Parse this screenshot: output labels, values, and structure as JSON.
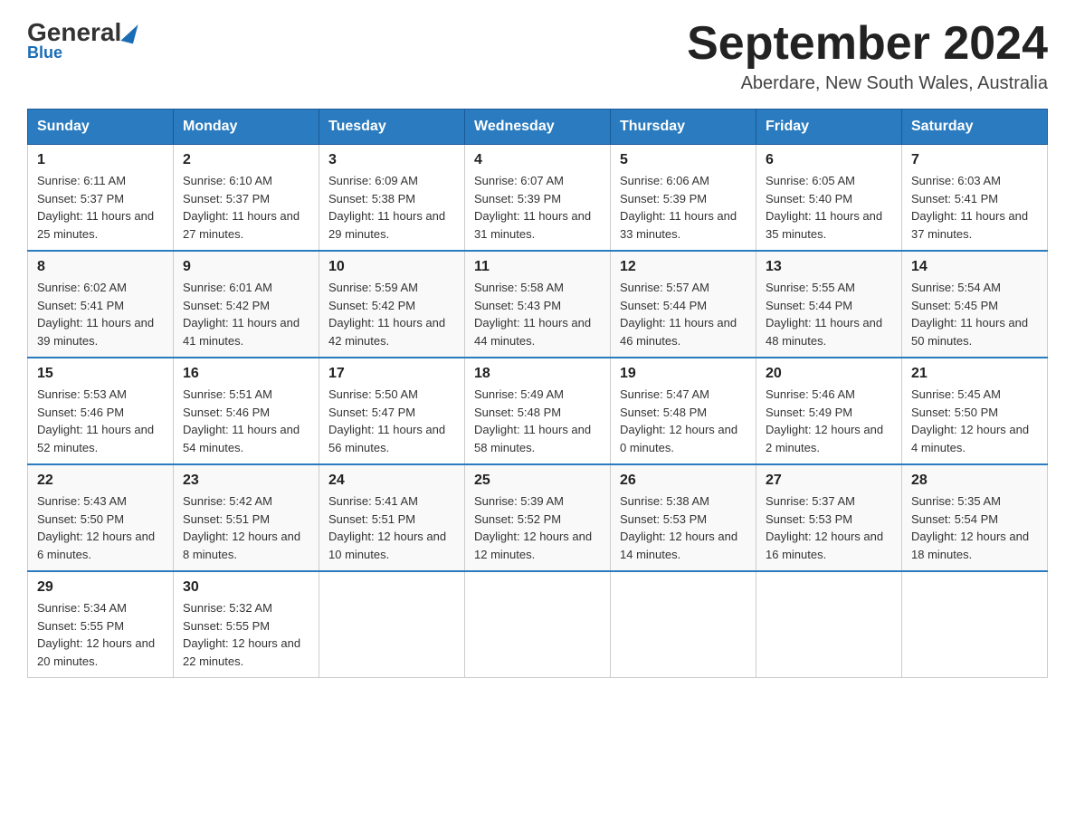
{
  "header": {
    "logo": {
      "general": "General",
      "blue": "Blue"
    },
    "title": "September 2024",
    "location": "Aberdare, New South Wales, Australia"
  },
  "days_of_week": [
    "Sunday",
    "Monday",
    "Tuesday",
    "Wednesday",
    "Thursday",
    "Friday",
    "Saturday"
  ],
  "weeks": [
    [
      {
        "day": "1",
        "sunrise": "6:11 AM",
        "sunset": "5:37 PM",
        "daylight": "11 hours and 25 minutes."
      },
      {
        "day": "2",
        "sunrise": "6:10 AM",
        "sunset": "5:37 PM",
        "daylight": "11 hours and 27 minutes."
      },
      {
        "day": "3",
        "sunrise": "6:09 AM",
        "sunset": "5:38 PM",
        "daylight": "11 hours and 29 minutes."
      },
      {
        "day": "4",
        "sunrise": "6:07 AM",
        "sunset": "5:39 PM",
        "daylight": "11 hours and 31 minutes."
      },
      {
        "day": "5",
        "sunrise": "6:06 AM",
        "sunset": "5:39 PM",
        "daylight": "11 hours and 33 minutes."
      },
      {
        "day": "6",
        "sunrise": "6:05 AM",
        "sunset": "5:40 PM",
        "daylight": "11 hours and 35 minutes."
      },
      {
        "day": "7",
        "sunrise": "6:03 AM",
        "sunset": "5:41 PM",
        "daylight": "11 hours and 37 minutes."
      }
    ],
    [
      {
        "day": "8",
        "sunrise": "6:02 AM",
        "sunset": "5:41 PM",
        "daylight": "11 hours and 39 minutes."
      },
      {
        "day": "9",
        "sunrise": "6:01 AM",
        "sunset": "5:42 PM",
        "daylight": "11 hours and 41 minutes."
      },
      {
        "day": "10",
        "sunrise": "5:59 AM",
        "sunset": "5:42 PM",
        "daylight": "11 hours and 42 minutes."
      },
      {
        "day": "11",
        "sunrise": "5:58 AM",
        "sunset": "5:43 PM",
        "daylight": "11 hours and 44 minutes."
      },
      {
        "day": "12",
        "sunrise": "5:57 AM",
        "sunset": "5:44 PM",
        "daylight": "11 hours and 46 minutes."
      },
      {
        "day": "13",
        "sunrise": "5:55 AM",
        "sunset": "5:44 PM",
        "daylight": "11 hours and 48 minutes."
      },
      {
        "day": "14",
        "sunrise": "5:54 AM",
        "sunset": "5:45 PM",
        "daylight": "11 hours and 50 minutes."
      }
    ],
    [
      {
        "day": "15",
        "sunrise": "5:53 AM",
        "sunset": "5:46 PM",
        "daylight": "11 hours and 52 minutes."
      },
      {
        "day": "16",
        "sunrise": "5:51 AM",
        "sunset": "5:46 PM",
        "daylight": "11 hours and 54 minutes."
      },
      {
        "day": "17",
        "sunrise": "5:50 AM",
        "sunset": "5:47 PM",
        "daylight": "11 hours and 56 minutes."
      },
      {
        "day": "18",
        "sunrise": "5:49 AM",
        "sunset": "5:48 PM",
        "daylight": "11 hours and 58 minutes."
      },
      {
        "day": "19",
        "sunrise": "5:47 AM",
        "sunset": "5:48 PM",
        "daylight": "12 hours and 0 minutes."
      },
      {
        "day": "20",
        "sunrise": "5:46 AM",
        "sunset": "5:49 PM",
        "daylight": "12 hours and 2 minutes."
      },
      {
        "day": "21",
        "sunrise": "5:45 AM",
        "sunset": "5:50 PM",
        "daylight": "12 hours and 4 minutes."
      }
    ],
    [
      {
        "day": "22",
        "sunrise": "5:43 AM",
        "sunset": "5:50 PM",
        "daylight": "12 hours and 6 minutes."
      },
      {
        "day": "23",
        "sunrise": "5:42 AM",
        "sunset": "5:51 PM",
        "daylight": "12 hours and 8 minutes."
      },
      {
        "day": "24",
        "sunrise": "5:41 AM",
        "sunset": "5:51 PM",
        "daylight": "12 hours and 10 minutes."
      },
      {
        "day": "25",
        "sunrise": "5:39 AM",
        "sunset": "5:52 PM",
        "daylight": "12 hours and 12 minutes."
      },
      {
        "day": "26",
        "sunrise": "5:38 AM",
        "sunset": "5:53 PM",
        "daylight": "12 hours and 14 minutes."
      },
      {
        "day": "27",
        "sunrise": "5:37 AM",
        "sunset": "5:53 PM",
        "daylight": "12 hours and 16 minutes."
      },
      {
        "day": "28",
        "sunrise": "5:35 AM",
        "sunset": "5:54 PM",
        "daylight": "12 hours and 18 minutes."
      }
    ],
    [
      {
        "day": "29",
        "sunrise": "5:34 AM",
        "sunset": "5:55 PM",
        "daylight": "12 hours and 20 minutes."
      },
      {
        "day": "30",
        "sunrise": "5:32 AM",
        "sunset": "5:55 PM",
        "daylight": "12 hours and 22 minutes."
      },
      null,
      null,
      null,
      null,
      null
    ]
  ],
  "labels": {
    "sunrise": "Sunrise: ",
    "sunset": "Sunset: ",
    "daylight": "Daylight: "
  }
}
